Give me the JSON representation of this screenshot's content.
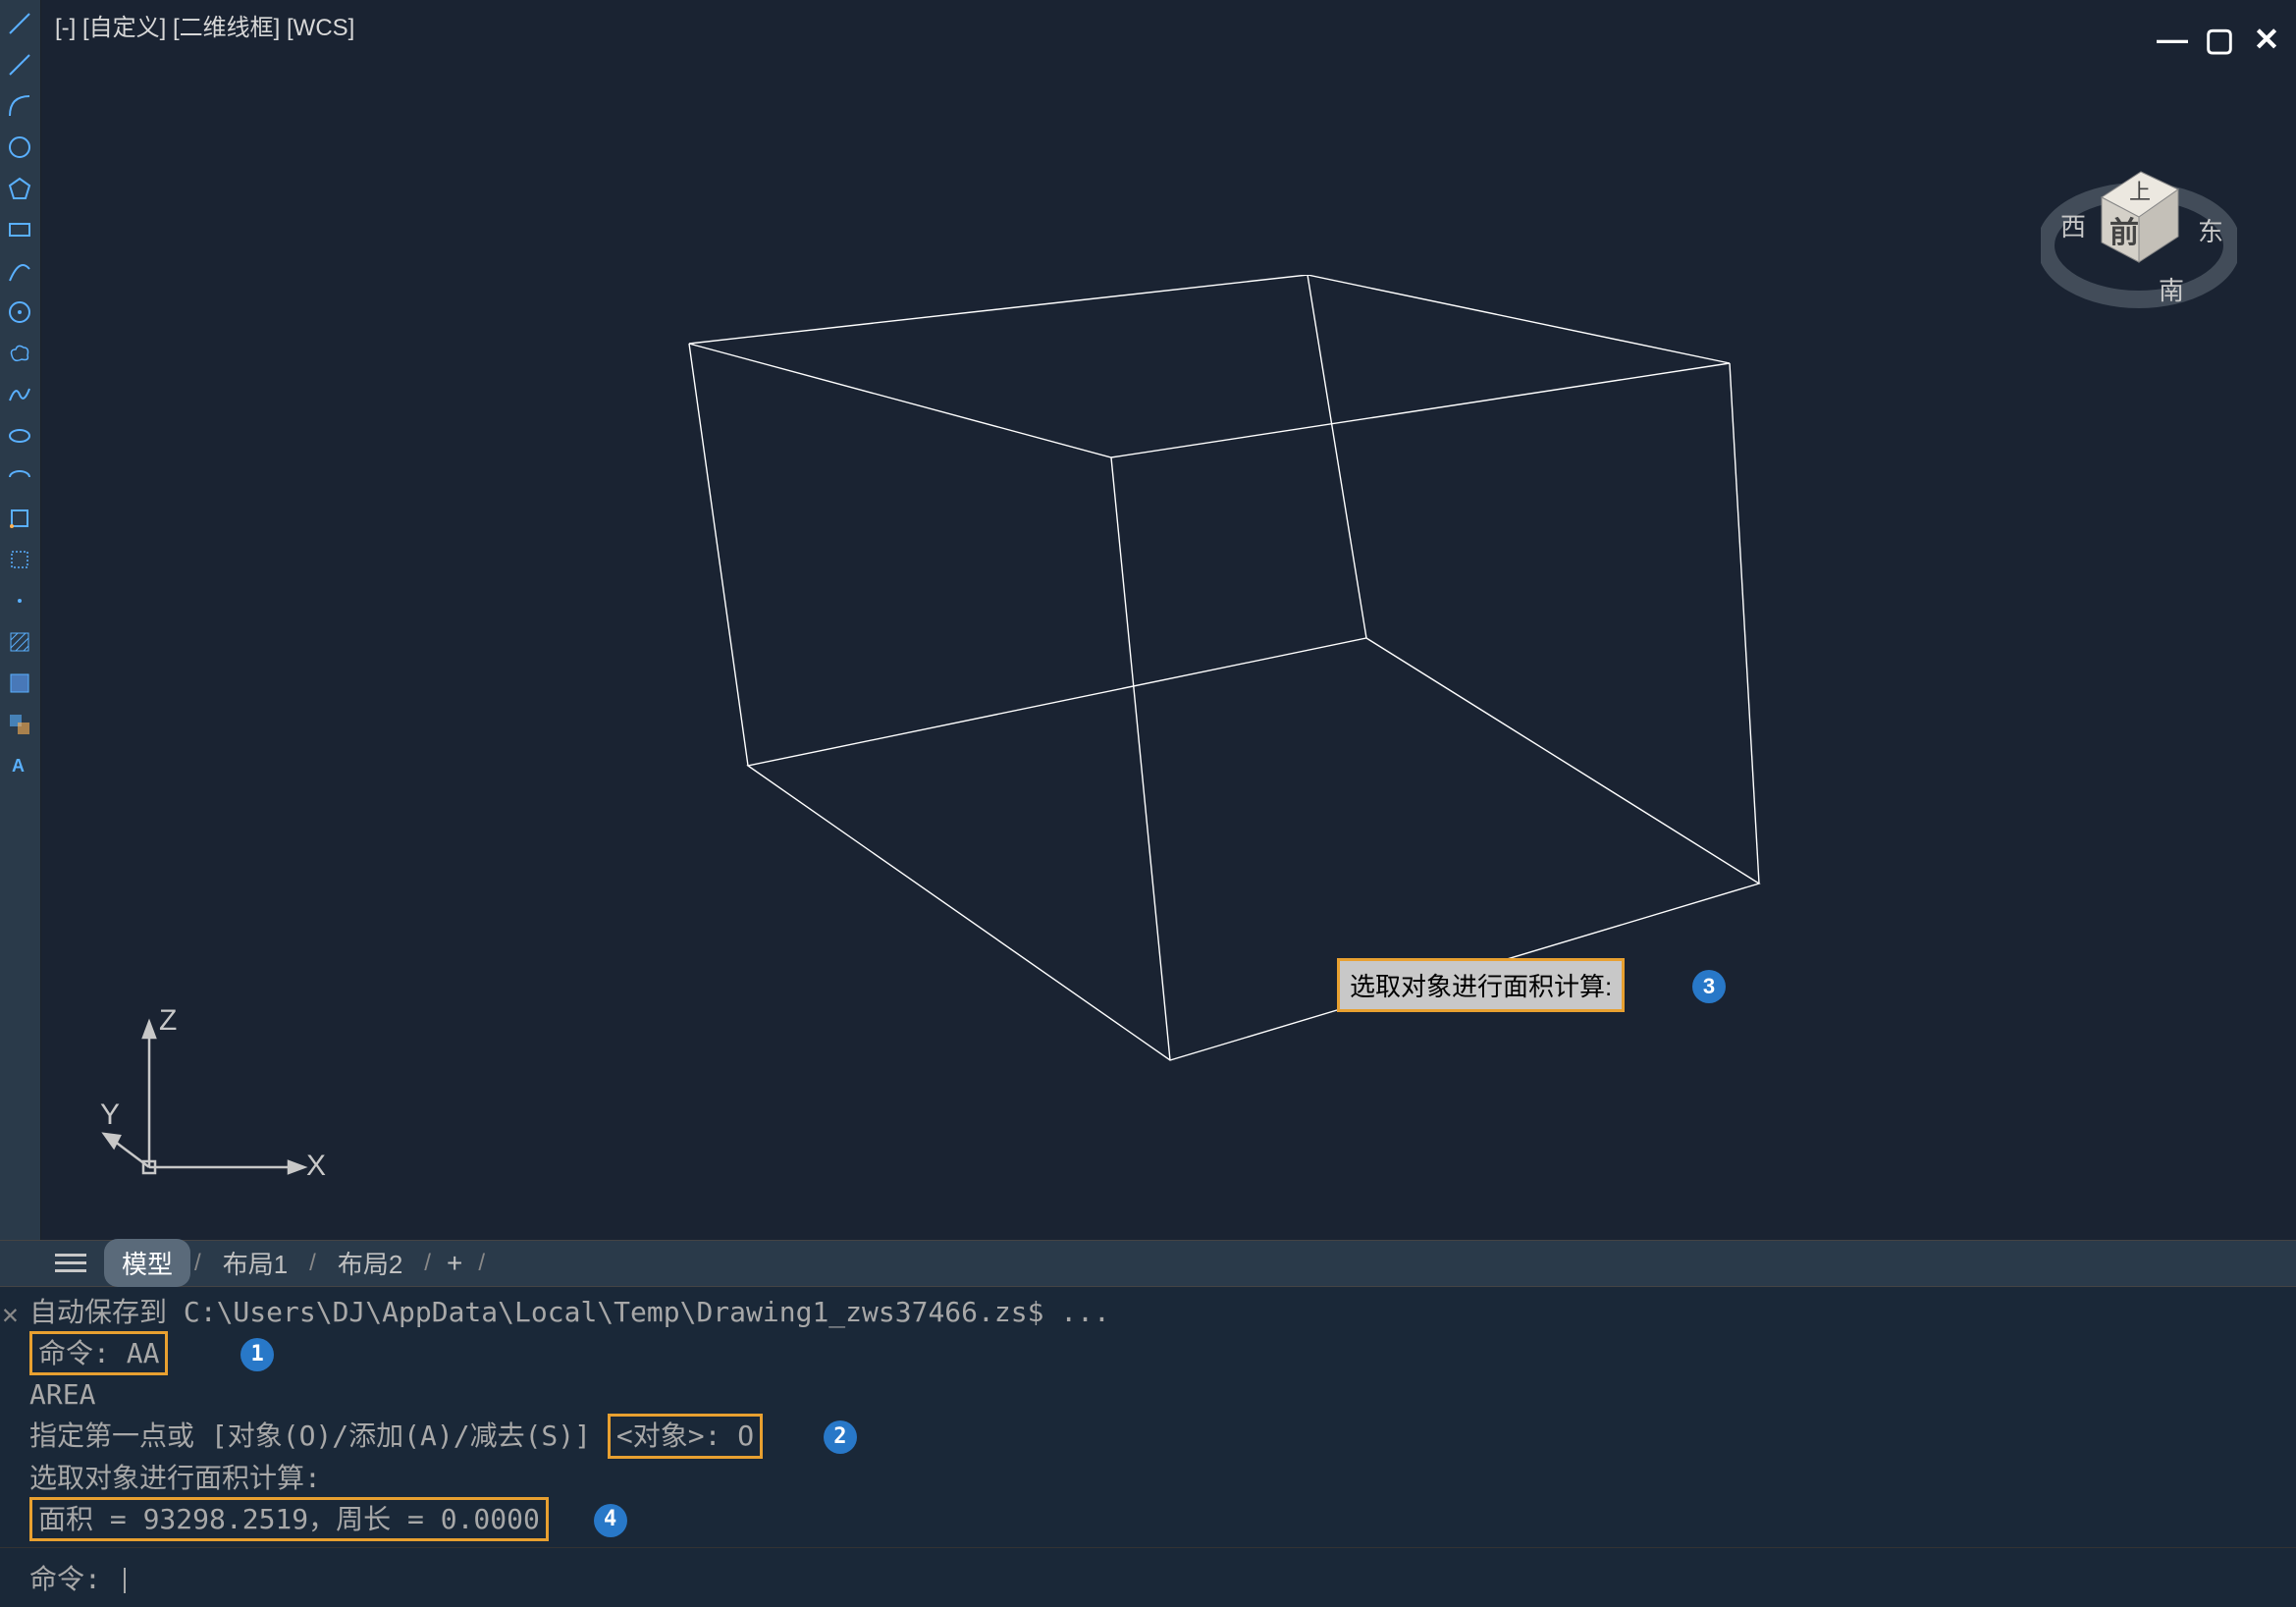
{
  "viewport": {
    "label": "[-] [自定义] [二维线框] [WCS]",
    "tooltip_text": "选取对象进行面积计算:",
    "viewcube": {
      "top": "上",
      "front": "前",
      "west": "西",
      "east": "东",
      "south": "南"
    },
    "ucs": {
      "x": "X",
      "y": "Y",
      "z": "Z"
    }
  },
  "tabs": {
    "model": "模型",
    "layout1": "布局1",
    "layout2": "布局2"
  },
  "command_history": {
    "autosave_prefix": "自动保存到 ",
    "autosave_path": "C:\\Users\\DJ\\AppData\\Local\\Temp\\Drawing1_zws37466.zs$ ...",
    "line1": "命令: AA",
    "line2": "AREA",
    "line3_prefix": "指定第一点或 [对象(O)/添加(A)/减去(S)]",
    "line3_hl": "<对象>: O",
    "line4": "选取对象进行面积计算:",
    "line5": "面积 = 93298.2519，周长 = 0.0000"
  },
  "command_input": {
    "prompt": "命令:"
  },
  "callouts": {
    "c1": "1",
    "c2": "2",
    "c3": "3",
    "c4": "4"
  }
}
